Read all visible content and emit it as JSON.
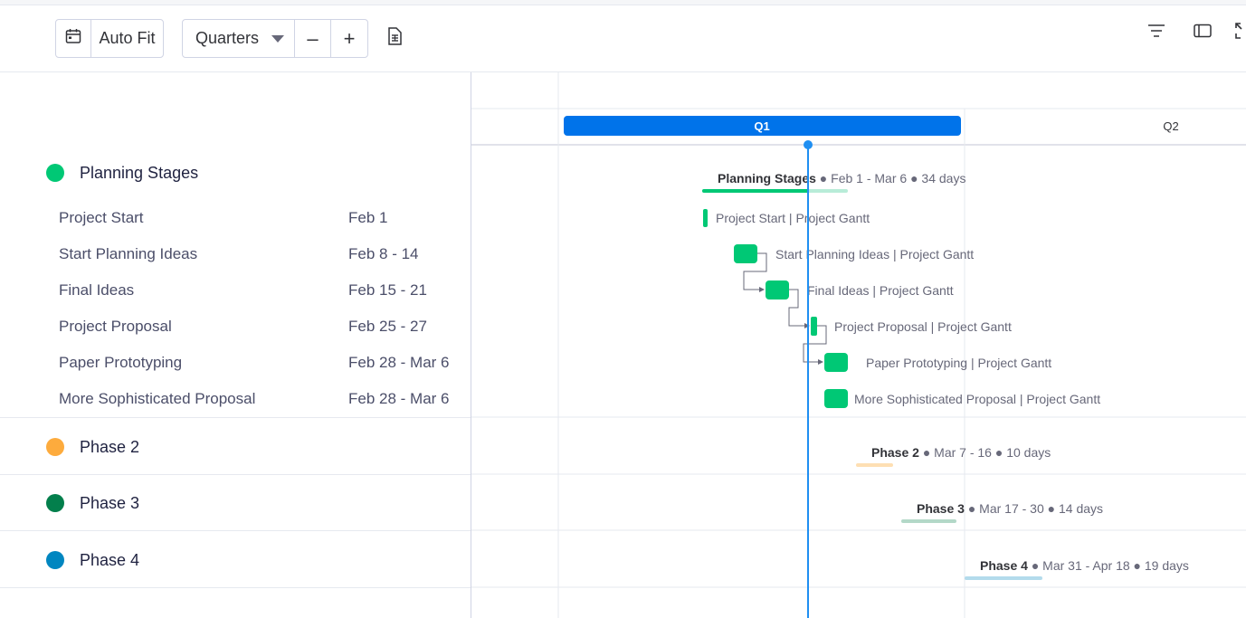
{
  "toolbar": {
    "auto_fit_label": "Auto Fit",
    "scale_select": "Quarters",
    "zoom_out_symbol": "–",
    "zoom_in_symbol": "+"
  },
  "timeline_header": {
    "q1_label": "Q1",
    "q2_label": "Q2"
  },
  "groups": [
    {
      "title": "Planning Stages",
      "color": "#00c875",
      "bar_label": "Planning Stages",
      "bar_info": " ● Feb 1 - Mar 6 ● 34 days",
      "tasks": [
        {
          "name": "Project Start",
          "date": "Feb 1",
          "bar_label": "Project Start | Project Gantt"
        },
        {
          "name": "Start Planning Ideas",
          "date": "Feb 8 - 14",
          "bar_label": "Start Planning Ideas | Project Gantt"
        },
        {
          "name": "Final Ideas",
          "date": "Feb 15 - 21",
          "bar_label": "Final Ideas | Project Gantt"
        },
        {
          "name": "Project Proposal",
          "date": "Feb 25 - 27",
          "bar_label": "Project Proposal | Project Gantt"
        },
        {
          "name": "Paper Prototyping",
          "date": "Feb 28 - Mar 6",
          "bar_label": "Paper Prototyping | Project Gantt"
        },
        {
          "name": "More Sophisticated Proposal",
          "date": "Feb 28 - Mar 6",
          "bar_label": "More Sophisticated Proposal | Project Gantt"
        }
      ]
    },
    {
      "title": "Phase 2",
      "color": "#fdab3d",
      "bar_label": "Phase 2",
      "bar_info": " ● Mar 7 - 16 ● 10 days"
    },
    {
      "title": "Phase 3",
      "color": "#037f4c",
      "bar_label": "Phase 3",
      "bar_info": " ● Mar 17 - 30 ● 14 days"
    },
    {
      "title": "Phase 4",
      "color": "#0086c0",
      "bar_label": "Phase 4",
      "bar_info": " ● Mar 31 - Apr 18 ● 19 days"
    }
  ],
  "colors": {
    "accent": "#0073ea",
    "today_line": "#1f8ff2",
    "task_bar": "#00c875"
  },
  "icons": {
    "calendar": "calendar-icon",
    "dropdown": "caret-down-icon",
    "export": "document-icon",
    "filter": "filter-icon",
    "panel": "side-panel-icon",
    "fullscreen": "expand-icon"
  }
}
